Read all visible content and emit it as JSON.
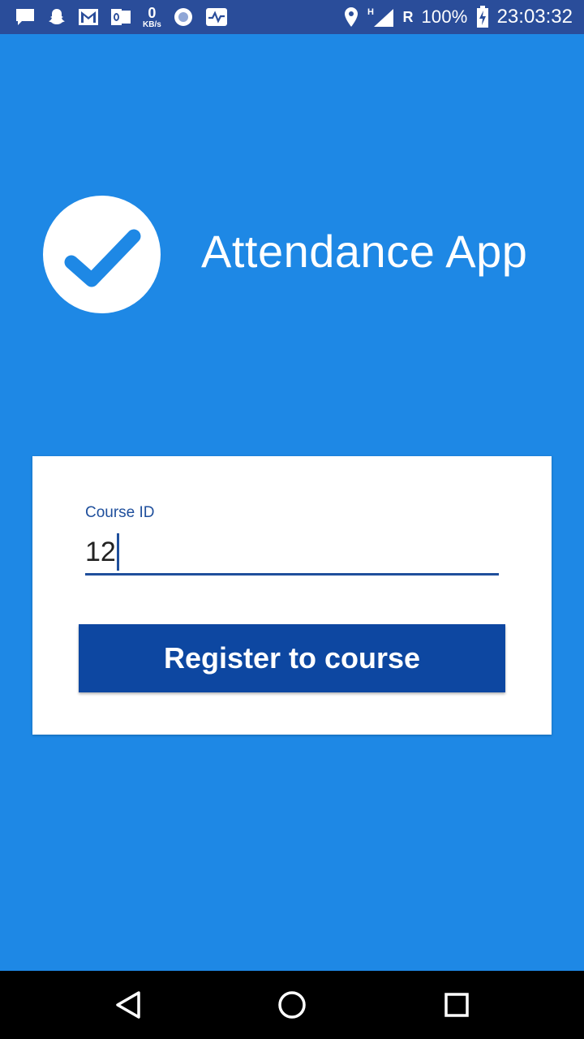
{
  "status_bar": {
    "left_icons": [
      "chat-icon",
      "snapchat-icon",
      "gmail-icon",
      "outlook-icon",
      "data-speed",
      "circle-app-icon",
      "activity-icon"
    ],
    "speed_value": "0",
    "speed_unit": "KB/s",
    "signal_type": "H",
    "roaming": "R",
    "battery": "100%",
    "time": "23:03:32"
  },
  "header": {
    "app_title": "Attendance App",
    "logo_icon": "check-circle-icon"
  },
  "form": {
    "course_label": "Course ID",
    "course_value": "12",
    "register_label": "Register to course"
  },
  "nav_bar": {
    "icons": [
      "back-icon",
      "home-icon",
      "recents-icon"
    ]
  },
  "colors": {
    "background": "#1e88e5",
    "status_bar": "#2a4d9a",
    "primary_dark": "#0d47a1",
    "accent_text": "#1f4f9c",
    "card": "#ffffff"
  }
}
